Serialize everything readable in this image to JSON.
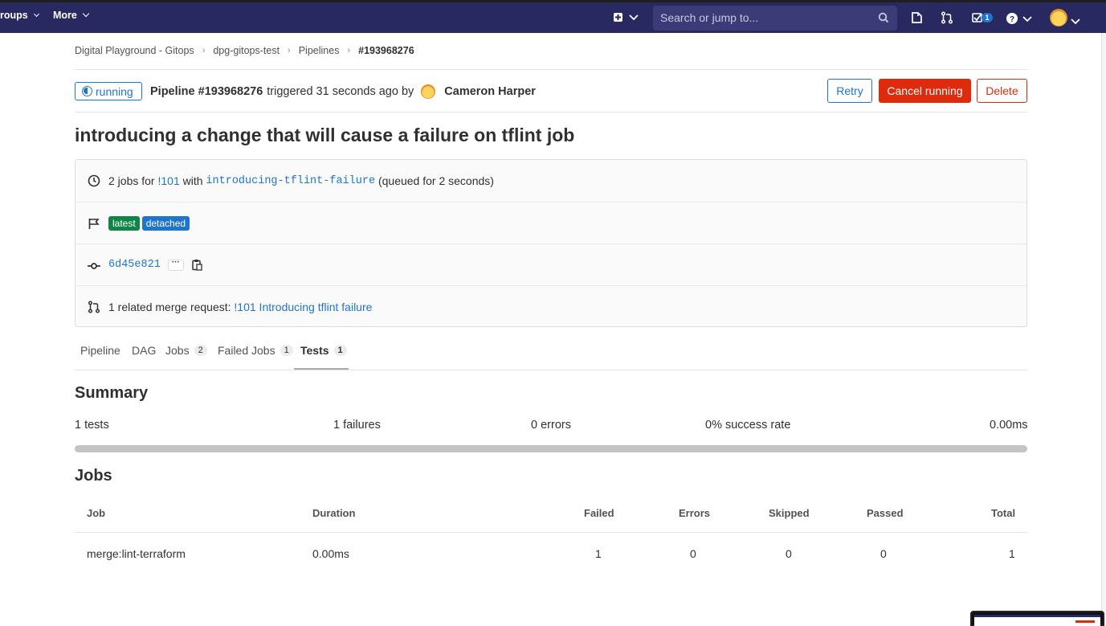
{
  "topbar": {
    "groups_label": "roups",
    "more_label": "More",
    "search_placeholder": "Search or jump to...",
    "todo_count": "1",
    "icons": [
      "plus-square-icon",
      "chevron-down-icon",
      "search-icon",
      "issues-icon",
      "merge-request-icon",
      "todo-icon",
      "help-icon",
      "avatar"
    ]
  },
  "breadcrumb": [
    "Digital Playground - Gitops",
    "dpg-gitops-test",
    "Pipelines",
    "#193968276"
  ],
  "header": {
    "status": "running",
    "pipeline_label": "Pipeline #193968276",
    "triggered_text": "triggered 31 seconds ago by",
    "author": "Cameron Harper",
    "retry": "Retry",
    "cancel": "Cancel running",
    "delete": "Delete"
  },
  "title": "introducing a change that will cause a failure on tflint job",
  "info": {
    "jobs_prefix": "2 jobs for",
    "mr_ref": "!101",
    "with": "with",
    "branch": "introducing-tflint-failure",
    "queued": "(queued for 2 seconds)",
    "badge_latest": "latest",
    "badge_detached": "detached",
    "commit_sha": "6d45e821",
    "related_prefix": "1 related merge request:",
    "related_link": "!101 Introducing tflint failure"
  },
  "tabs": [
    {
      "label": "Pipeline",
      "count": ""
    },
    {
      "label": "DAG",
      "count": ""
    },
    {
      "label": "Jobs",
      "count": "2"
    },
    {
      "label": "Failed Jobs",
      "count": "1"
    },
    {
      "label": "Tests",
      "count": "1",
      "active": true
    }
  ],
  "summary": {
    "heading": "Summary",
    "tests": "1 tests",
    "failures": "1 failures",
    "errors": "0 errors",
    "success_rate": "0% success rate",
    "duration": "0.00ms",
    "success_fraction": 0
  },
  "jobs": {
    "heading": "Jobs",
    "columns": [
      "Job",
      "Duration",
      "Failed",
      "Errors",
      "Skipped",
      "Passed",
      "Total"
    ],
    "rows": [
      [
        "merge:lint-terraform",
        "0.00ms",
        "1",
        "0",
        "0",
        "0",
        "1"
      ]
    ]
  },
  "colors": {
    "topbar": "#292961",
    "accent": "#1f75cb",
    "danger": "#dd2b0e",
    "success": "#108548"
  }
}
